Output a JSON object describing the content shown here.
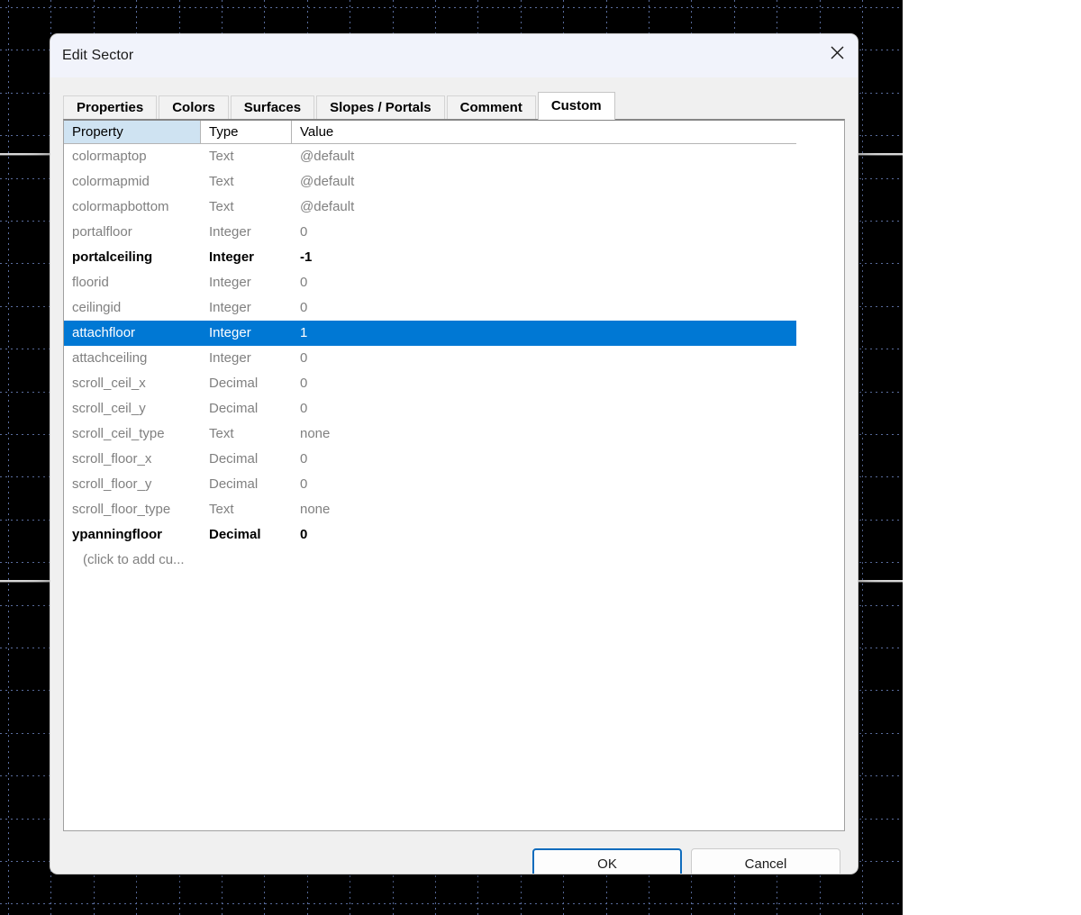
{
  "dialog": {
    "title": "Edit Sector",
    "close_icon": "close-icon"
  },
  "tabs": [
    {
      "label": "Properties",
      "active": false
    },
    {
      "label": "Colors",
      "active": false
    },
    {
      "label": "Surfaces",
      "active": false
    },
    {
      "label": "Slopes / Portals",
      "active": false
    },
    {
      "label": "Comment",
      "active": false
    },
    {
      "label": "Custom",
      "active": true
    }
  ],
  "table": {
    "columns": [
      "Property",
      "Type",
      "Value"
    ],
    "sorted_column": "Property",
    "rows": [
      {
        "property": "colormaptop",
        "type": "Text",
        "value": "@default",
        "modified": false,
        "selected": false
      },
      {
        "property": "colormapmid",
        "type": "Text",
        "value": "@default",
        "modified": false,
        "selected": false
      },
      {
        "property": "colormapbottom",
        "type": "Text",
        "value": "@default",
        "modified": false,
        "selected": false
      },
      {
        "property": "portalfloor",
        "type": "Integer",
        "value": "0",
        "modified": false,
        "selected": false
      },
      {
        "property": "portalceiling",
        "type": "Integer",
        "value": "-1",
        "modified": true,
        "selected": false
      },
      {
        "property": "floorid",
        "type": "Integer",
        "value": "0",
        "modified": false,
        "selected": false
      },
      {
        "property": "ceilingid",
        "type": "Integer",
        "value": "0",
        "modified": false,
        "selected": false
      },
      {
        "property": "attachfloor",
        "type": "Integer",
        "value": "1",
        "modified": true,
        "selected": true
      },
      {
        "property": "attachceiling",
        "type": "Integer",
        "value": "0",
        "modified": false,
        "selected": false
      },
      {
        "property": "scroll_ceil_x",
        "type": "Decimal",
        "value": "0",
        "modified": false,
        "selected": false
      },
      {
        "property": "scroll_ceil_y",
        "type": "Decimal",
        "value": "0",
        "modified": false,
        "selected": false
      },
      {
        "property": "scroll_ceil_type",
        "type": "Text",
        "value": "none",
        "modified": false,
        "selected": false
      },
      {
        "property": "scroll_floor_x",
        "type": "Decimal",
        "value": "0",
        "modified": false,
        "selected": false
      },
      {
        "property": "scroll_floor_y",
        "type": "Decimal",
        "value": "0",
        "modified": false,
        "selected": false
      },
      {
        "property": "scroll_floor_type",
        "type": "Text",
        "value": "none",
        "modified": false,
        "selected": false
      },
      {
        "property": "ypanningfloor",
        "type": "Decimal",
        "value": "0",
        "modified": true,
        "selected": false
      }
    ],
    "add_row_label": "(click to add cu..."
  },
  "footer": {
    "ok_label": "OK",
    "cancel_label": "Cancel"
  },
  "colors": {
    "accent": "#0078d4",
    "focus_border": "#0f6cbd",
    "sorted_header": "#cfe3f2",
    "titlebar": "#f1f3fb",
    "dialog_bg": "#f0f0f0",
    "grid_line": "#5a6d9e",
    "canvas_bg": "#000000"
  }
}
